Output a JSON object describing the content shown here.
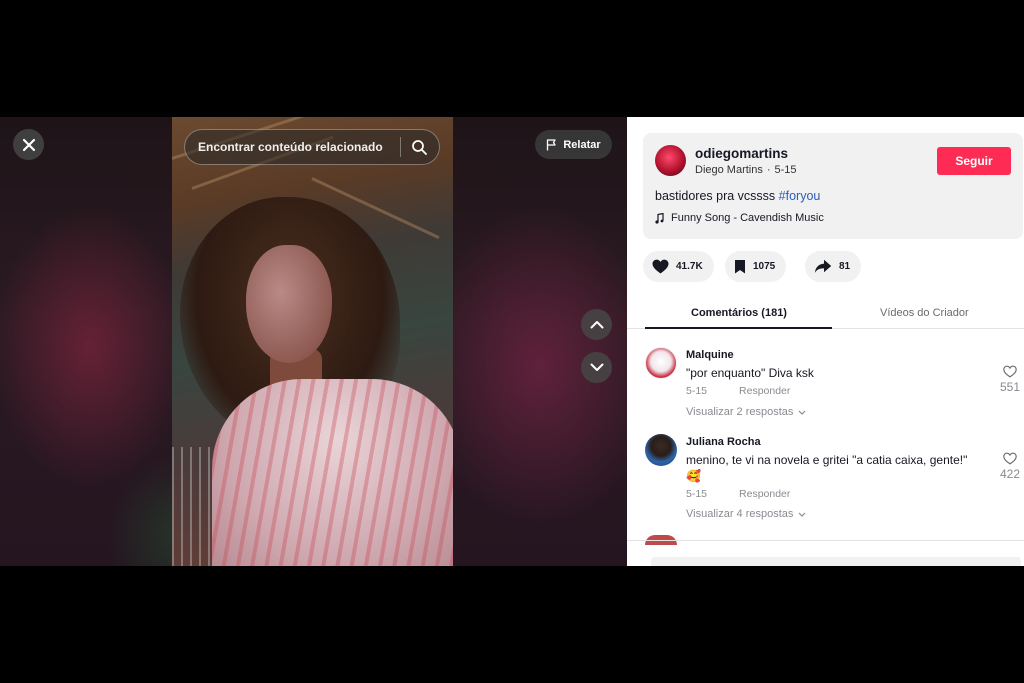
{
  "player": {
    "search_placeholder": "Encontrar conteúdo relacionado",
    "report_label": "Relatar"
  },
  "post": {
    "username": "odiegomartins",
    "display_name": "Diego Martins",
    "separator": "·",
    "date": "5-15",
    "follow_label": "Seguir",
    "caption_text": "bastidores pra vcssss",
    "hashtag": "#foryou",
    "music": "Funny Song - Cavendish Music"
  },
  "actions": {
    "likes": "41.7K",
    "saves": "1075",
    "shares": "81"
  },
  "tabs": {
    "comments": "Comentários (181)",
    "creator_videos": "Vídeos do Criador"
  },
  "comments": [
    {
      "name": "Malquine",
      "text": "\"por enquanto\" Diva ksk",
      "date": "5-15",
      "reply_label": "Responder",
      "view_replies": "Visualizar 2 respostas",
      "likes": "551"
    },
    {
      "name": "Juliana Rocha",
      "text": "menino, te vi na novela e gritei \"a catia caixa, gente!\"",
      "emoji": "🥰",
      "date": "5-15",
      "reply_label": "Responder",
      "view_replies": "Visualizar 4 respostas",
      "likes": "422"
    }
  ],
  "colors": {
    "follow": "#fe2c55",
    "hashtag": "#2b5db9",
    "text": "#161823",
    "muted": "#8a8b91"
  },
  "icons": [
    "close-icon",
    "search-icon",
    "flag-icon",
    "chevron-up-icon",
    "chevron-down-icon",
    "music-note-icon",
    "heart-icon",
    "bookmark-icon",
    "share-icon"
  ]
}
